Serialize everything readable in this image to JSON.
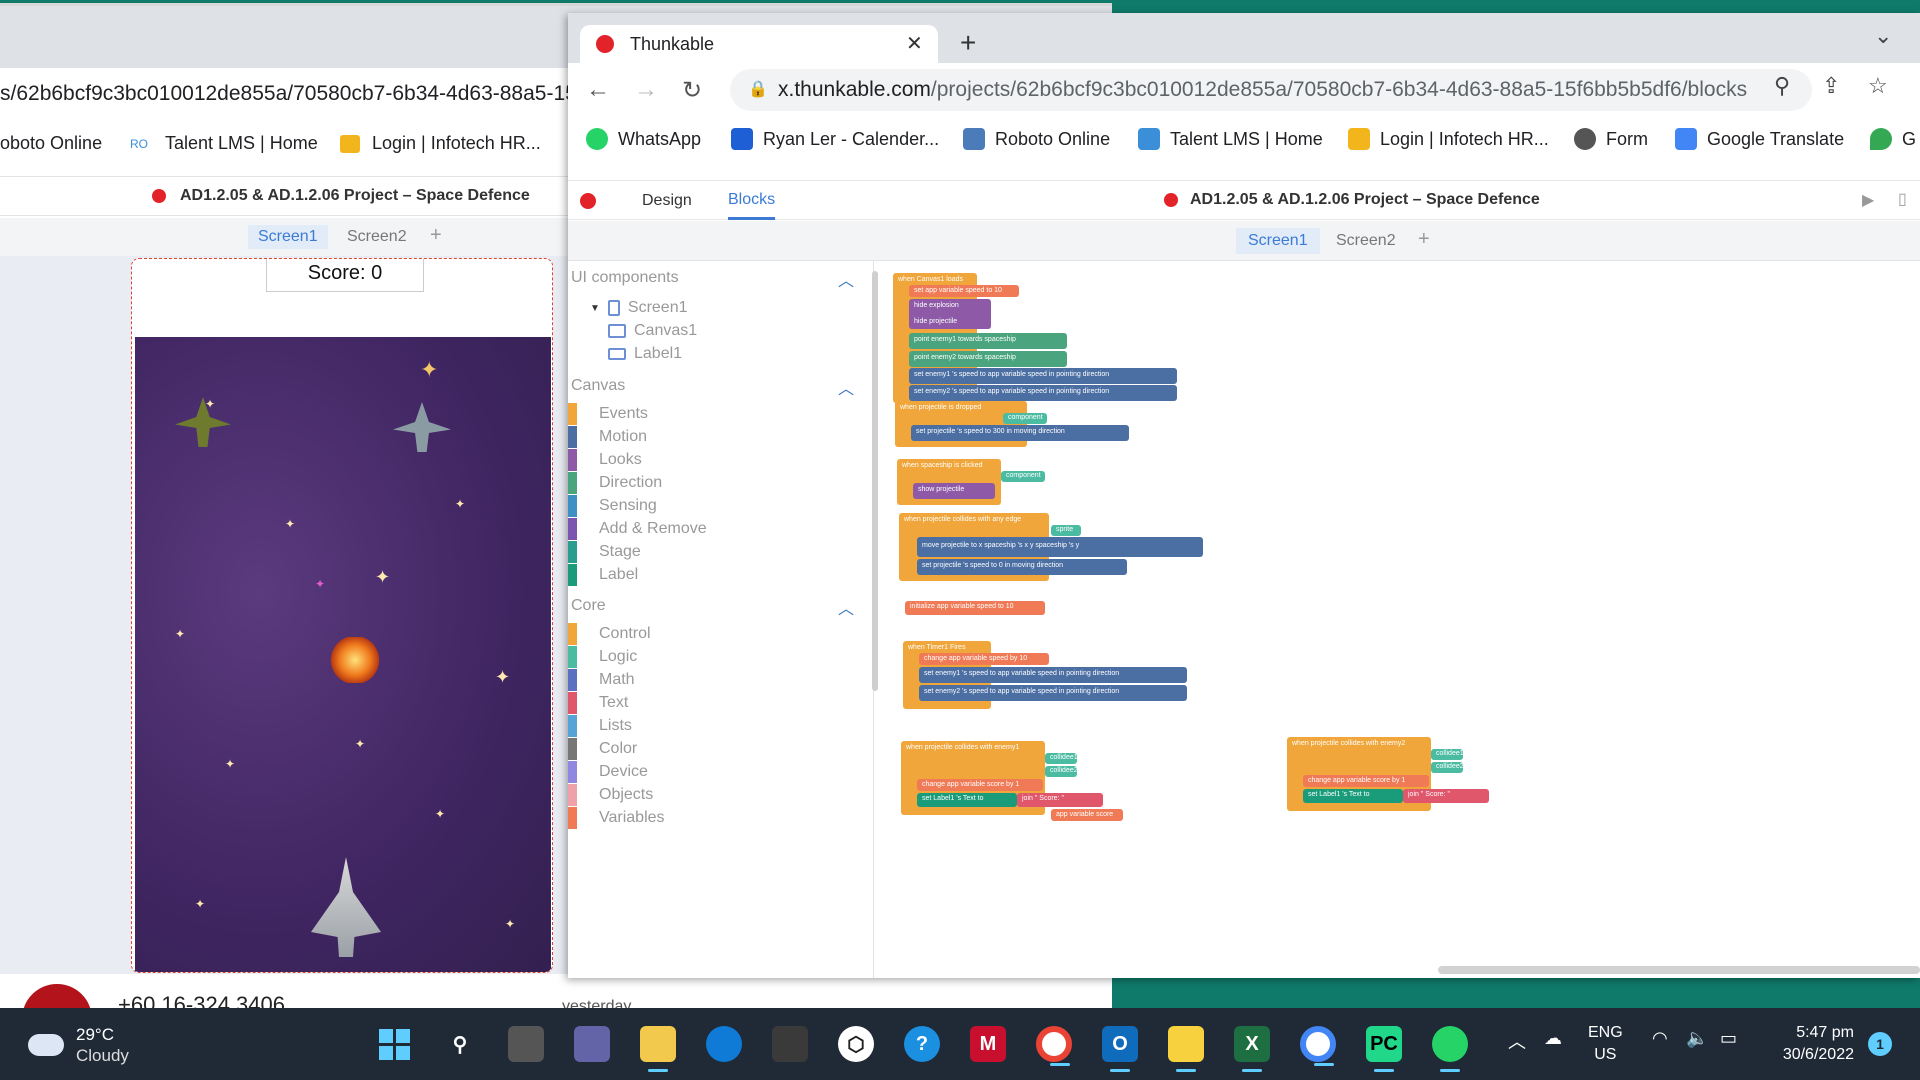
{
  "background_window": {
    "url_fragment": "s/62b6bcf9c3bc010012de855a/70580cb7-6b34-4d63-88a5-15",
    "bookmarks": [
      "oboto Online",
      "Talent LMS | Home",
      "Login | Infotech HR..."
    ],
    "project_title": "AD1.2.05 & AD.1.2.06 Project – Space Defence",
    "screens": [
      "Screen1",
      "Screen2",
      "+"
    ],
    "score_label": "Score: 0",
    "contact_phone": "+60 16-324 3406",
    "contact_time": "yesterday"
  },
  "browser": {
    "tab_title": "Thunkable",
    "tab_close": "✕",
    "new_tab": "+",
    "url_host": "x.thunkable.com",
    "url_path": "/projects/62b6bcf9c3bc010012de855a/70580cb7-6b34-4d63-88a5-15f6bb5b5df6/blocks",
    "bookmarks": [
      {
        "label": "WhatsApp",
        "color": "#25d366"
      },
      {
        "label": "Ryan Ler - Calender...",
        "color": "#1f5fd6"
      },
      {
        "label": "Roboto Online",
        "color": "#4b7bb8"
      },
      {
        "label": "Talent LMS | Home",
        "color": "#3a8fd8"
      },
      {
        "label": "Login | Infotech HR...",
        "color": "#f2b51c"
      },
      {
        "label": "Form",
        "color": "#555555"
      },
      {
        "label": "Google Translate",
        "color": "#4285f4"
      },
      {
        "label": "G",
        "color": "#34a853"
      }
    ]
  },
  "app": {
    "design_tab": "Design",
    "blocks_tab": "Blocks",
    "project_title": "AD1.2.05 & AD.1.2.06 Project – Space Defence",
    "screens": {
      "s1": "Screen1",
      "s2": "Screen2",
      "add": "+"
    }
  },
  "palette": {
    "ui_components": "UI components",
    "tree": [
      "Screen1",
      "Canvas1",
      "Label1"
    ],
    "canvas_title": "Canvas",
    "canvas_items": [
      {
        "label": "Events",
        "color": "#f0a63b"
      },
      {
        "label": "Motion",
        "color": "#4b6ea3"
      },
      {
        "label": "Looks",
        "color": "#8e5aa8"
      },
      {
        "label": "Direction",
        "color": "#4aa57f"
      },
      {
        "label": "Sensing",
        "color": "#3d8fc6"
      },
      {
        "label": "Add & Remove",
        "color": "#7b55b0"
      },
      {
        "label": "Stage",
        "color": "#2a9d8f"
      },
      {
        "label": "Label",
        "color": "#1a9b7a"
      }
    ],
    "core_title": "Core",
    "core_items": [
      {
        "label": "Control",
        "color": "#f0a63b"
      },
      {
        "label": "Logic",
        "color": "#4bbba2"
      },
      {
        "label": "Math",
        "color": "#5b70c0"
      },
      {
        "label": "Text",
        "color": "#e0566b"
      },
      {
        "label": "Lists",
        "color": "#56a4d6"
      },
      {
        "label": "Color",
        "color": "#777777"
      },
      {
        "label": "Device",
        "color": "#8f87e0"
      },
      {
        "label": "Objects",
        "color": "#f0a0a8"
      },
      {
        "label": "Variables",
        "color": "#f07a56"
      }
    ]
  },
  "blocks": {
    "b1": "when Canvas1 loads",
    "b1a": "set app variable speed to 10",
    "b1b": "hide explosion",
    "b1c": "hide projectile",
    "b1d": "point enemy1 towards spaceship",
    "b1e": "point enemy2 towards spaceship",
    "b1f": "set enemy1 's speed to app variable speed in pointing direction",
    "b1g": "set enemy2 's speed to app variable speed in pointing direction",
    "b2": "when projectile is dropped",
    "b2c": "component",
    "b2a": "set projectile 's speed to 300 in moving direction",
    "b3": "when spaceship is clicked",
    "b3c": "component",
    "b3a": "show projectile",
    "b4": "when projectile collides with any edge",
    "b4c": "sprite",
    "b4a": "move projectile to x spaceship 's x  y spaceship 's y",
    "b4b": "set projectile 's speed to 0 in moving direction",
    "b5": "initialize app variable speed to 10",
    "b6": "when Timer1 Fires",
    "b6a": "change app variable speed by 10",
    "b6b": "set enemy1 's speed to app variable speed in pointing direction",
    "b6c": "set enemy2 's speed to app variable speed in pointing direction",
    "b7": "when projectile collides with enemy1",
    "b7c1": "collidee1",
    "b7c2": "collidee2",
    "b7a": "change app variable score by 1",
    "b7b": "set Label1 's Text to",
    "b7j": "join \" Score: \"",
    "b7s": "app variable score",
    "b8": "when projectile collides with enemy2",
    "b8c1": "collidee1",
    "b8c2": "collidee2",
    "b8a": "change app variable score by 1",
    "b8b": "set Label1 's Text to",
    "b8j": "join \" Score: \""
  },
  "taskbar": {
    "temp": "29°C",
    "condition": "Cloudy",
    "lang1": "ENG",
    "lang2": "US",
    "time": "5:47 pm",
    "date": "30/6/2022",
    "notifications": "1"
  }
}
